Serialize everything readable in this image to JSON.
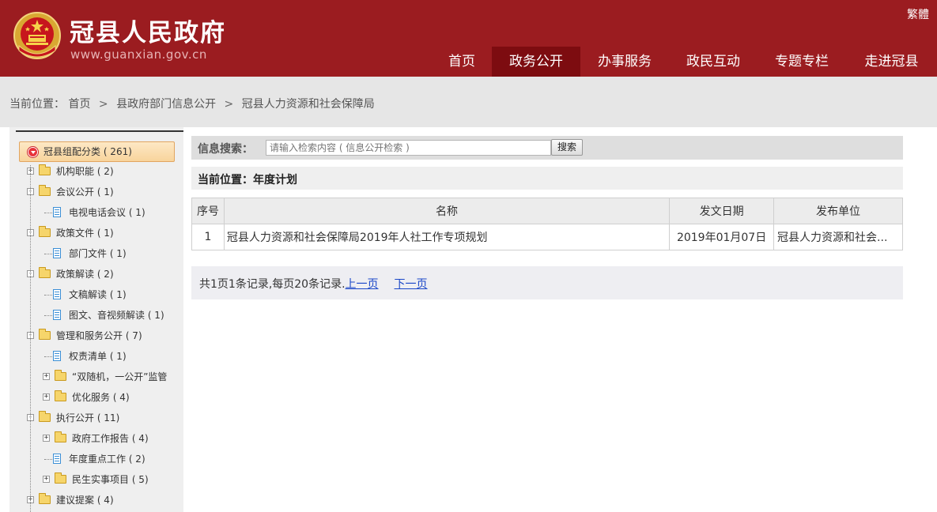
{
  "header": {
    "title": "冠县人民政府",
    "domain": "www.guanxian.gov.cn",
    "traditional_link": "繁體",
    "nav": [
      {
        "label": "首页",
        "active": false
      },
      {
        "label": "政务公开",
        "active": true
      },
      {
        "label": "办事服务",
        "active": false
      },
      {
        "label": "政民互动",
        "active": false
      },
      {
        "label": "专题专栏",
        "active": false
      },
      {
        "label": "走进冠县",
        "active": false
      }
    ]
  },
  "breadcrumb": {
    "prefix": "当前位置：",
    "items": [
      "首页",
      "县政府部门信息公开",
      "冠县人力资源和社会保障局"
    ],
    "separator": ">"
  },
  "sidebar": {
    "root": "冠县组配分类 ( 261)",
    "nodes": [
      {
        "label": "机构职能 ( 2)",
        "type": "folder",
        "toggle": "+"
      },
      {
        "label": "会议公开 ( 1)",
        "type": "folder",
        "toggle": "-"
      },
      {
        "label": "电视电话会议 ( 1)",
        "type": "doc"
      },
      {
        "label": "政策文件 ( 1)",
        "type": "folder",
        "toggle": "-"
      },
      {
        "label": "部门文件 ( 1)",
        "type": "doc"
      },
      {
        "label": "政策解读 ( 2)",
        "type": "folder",
        "toggle": "-"
      },
      {
        "label": "文稿解读 ( 1)",
        "type": "doc"
      },
      {
        "label": "图文、音视频解读 ( 1)",
        "type": "doc"
      },
      {
        "label": "管理和服务公开 ( 7)",
        "type": "folder",
        "toggle": "-"
      },
      {
        "label": "权责清单 ( 1)",
        "type": "doc"
      },
      {
        "label": "“双随机，一公开”监管",
        "type": "folder",
        "toggle": "+"
      },
      {
        "label": "优化服务 ( 4)",
        "type": "folder",
        "toggle": "+"
      },
      {
        "label": "执行公开 ( 11)",
        "type": "folder",
        "toggle": "-"
      },
      {
        "label": "政府工作报告 ( 4)",
        "type": "folder",
        "toggle": "+"
      },
      {
        "label": "年度重点工作 ( 2)",
        "type": "doc"
      },
      {
        "label": "民生实事项目 ( 5)",
        "type": "folder",
        "toggle": "+"
      },
      {
        "label": "建议提案 ( 4)",
        "type": "folder",
        "toggle": "+"
      }
    ]
  },
  "search": {
    "label": "信息搜索：",
    "placeholder": "请输入检索内容 ( 信息公开检索 )",
    "button": "搜索"
  },
  "position": {
    "title": "当前位置：年度计划"
  },
  "table": {
    "headers": [
      "序号",
      "名称",
      "发文日期",
      "发布单位"
    ],
    "rows": [
      {
        "no": "1",
        "name": "冠县人力资源和社会保障局2019年人社工作专项规划",
        "date": "2019年01月07日",
        "unit": "冠县人力资源和社会..."
      }
    ]
  },
  "pager": {
    "summary": "共1页1条记录,每页20条记录.",
    "prev": "上一页",
    "next": "下一页"
  },
  "colors": {
    "header_bg": "#9b1c20",
    "nav_active_bg": "#7d0c10",
    "link_blue": "#1a47c8"
  }
}
